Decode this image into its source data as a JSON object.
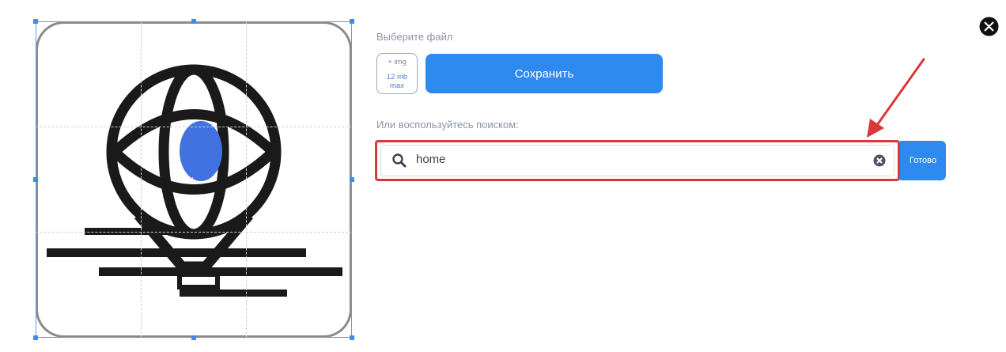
{
  "upload": {
    "title": "Выберите файл",
    "hint_plus": "+ img",
    "hint_size": "12 mb",
    "hint_max": "max"
  },
  "save_label": "Сохранить",
  "search": {
    "title": "Или воспользуйтесь поиском:",
    "value": "home"
  },
  "done_label": "Готово",
  "icons": {
    "close": "close-icon",
    "search": "search-icon",
    "clear": "clear-icon",
    "annotation": "arrow-annotation"
  },
  "colors": {
    "accent": "#2f8aef",
    "annotation": "#d9383a"
  }
}
